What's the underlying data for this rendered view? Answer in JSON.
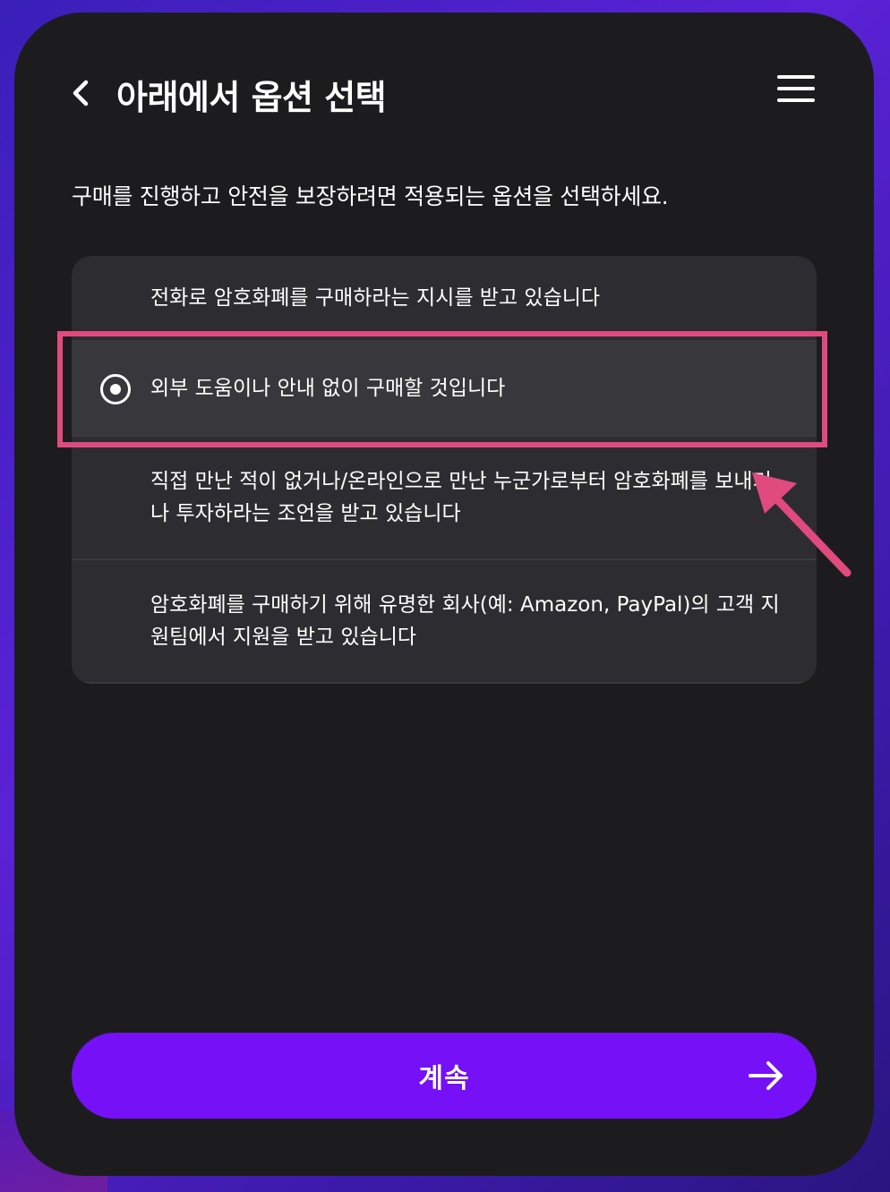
{
  "header": {
    "title": "아래에서 옵션 선택",
    "back_icon": "chevron-left-icon",
    "menu_icon": "hamburger-menu-icon"
  },
  "subtitle": "구매를 진행하고 안전을 보장하려면 적용되는 옵션을 선택하세요.",
  "options": [
    {
      "label": "전화로 암호화폐를 구매하라는 지시를 받고 있습니다",
      "selected": false
    },
    {
      "label": "외부 도움이나 안내 없이 구매할 것입니다",
      "selected": true
    },
    {
      "label": "직접 만난 적이 없거나/온라인으로 만난 누군가로부터 암호화폐를 보내거나 투자하라는 조언을 받고 있습니다",
      "selected": false
    },
    {
      "label": "암호화폐를 구매하기 위해 유명한 회사(예: Amazon, PayPal)의 고객 지원팀에서 지원을 받고 있습니다",
      "selected": false
    }
  ],
  "continue_button": {
    "label": "계속",
    "icon": "arrow-right-icon"
  },
  "colors": {
    "accent": "#7510f7",
    "annotation": "#e04a7c",
    "card_bg": "#1c1c1f",
    "option_bg": "#2d2d31"
  }
}
